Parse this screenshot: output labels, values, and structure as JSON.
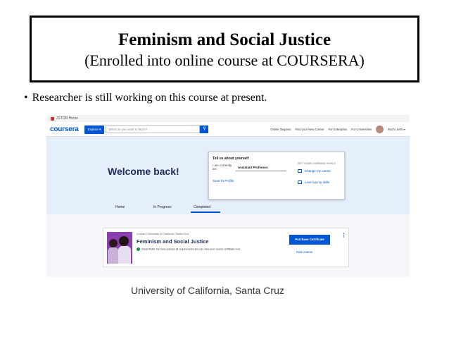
{
  "slide": {
    "title": "Feminism and Social Justice",
    "subtitle": "(Enrolled into online course at COURSERA)",
    "bullet": "Researcher is still working on this course at present.",
    "bullet_symbol": "•",
    "caption": "University of California, Santa Cruz"
  },
  "screenshot": {
    "browser_tab": "JSTOR Home",
    "logo": "coursera",
    "explore_label": "Explore ▾",
    "search_placeholder": "What do you want to learn?",
    "search_icon": "search-icon",
    "nav_links": [
      "Online Degrees",
      "Find your New Career",
      "For Enterprise",
      "For Universities"
    ],
    "user_name": "Ruchi Joshi ▾",
    "welcome": "Welcome back!",
    "tabs": [
      "Home",
      "In Progress",
      "Completed"
    ],
    "active_tab": "Completed",
    "popup": {
      "heading": "Tell us about yourself",
      "i_am": "I am currently an:",
      "role": "Assistant Professor",
      "save": "Save To Profile",
      "goals_heading": "SET YOUR LEARNING GOALS",
      "goal_1": "Change my career",
      "goal_2": "Level up my skills"
    },
    "course": {
      "meta": "Course | University of California, Santa Cruz",
      "name": "Feminism and Social Justice",
      "status": "Great Work! You have passed all requirements and can view your course certificate now.",
      "purchase": "Purchase Certificate",
      "rate": "Rate course",
      "more": "⋮"
    },
    "colors": {
      "brand": "#0056d2",
      "hero_bg": "#e5eefb",
      "success": "#1e8e3e"
    }
  }
}
